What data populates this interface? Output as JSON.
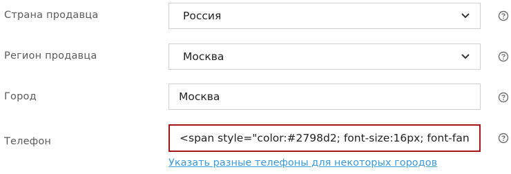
{
  "form": {
    "rows": [
      {
        "label": "Страна продавца",
        "value": "Россия",
        "control": "select"
      },
      {
        "label": "Регион продавца",
        "value": "Москва",
        "control": "select"
      },
      {
        "label": "Город",
        "value": "Москва",
        "control": "text"
      },
      {
        "label": "Телефон",
        "value": "<span style=\"color:#2798d2; font-size:16px; font-fan",
        "control": "text-error"
      }
    ],
    "phone_link": "Указать разные телефоны для некоторых городов"
  },
  "icons": {
    "select_arrow": "chevron-down-icon",
    "help": "question-circle-icon"
  },
  "colors": {
    "label": "#5a5a5a",
    "border": "#cfcfcf",
    "error_border": "#a51414",
    "link": "#3a9ad9"
  }
}
